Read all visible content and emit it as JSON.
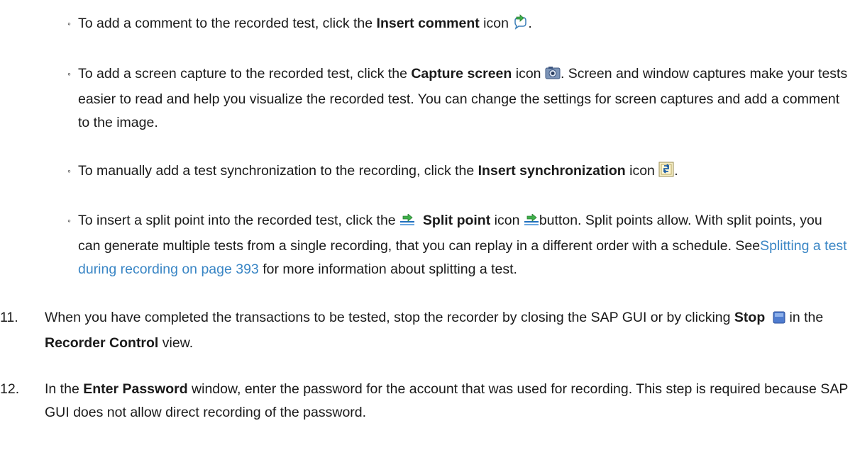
{
  "steps": [
    {
      "type": "bullet",
      "pre": "To add a comment to the recorded test, click the ",
      "bold": "Insert comment",
      "post": " icon ",
      "end": ".",
      "icon": "insert-comment-icon"
    },
    {
      "type": "bullet",
      "pre": "To add a screen capture to the recorded test, click the ",
      "bold": "Capture screen",
      "post": " icon ",
      "end": ". Screen and window captures make your tests easier to read and help you visualize the recorded test. You can change the settings for screen captures and add a comment to the image.",
      "icon": "camera-icon"
    },
    {
      "type": "bullet",
      "pre": "To manually add a test synchronization to the recording, click the ",
      "bold": "Insert synchronization",
      "post": " icon ",
      "end": ".",
      "icon": "synchronization-icon"
    },
    {
      "type": "bullet",
      "pre": "To insert a split point into the recorded test, click the ",
      "bold": "Split point",
      "post": " icon ",
      "mid": "button. Split points allow. With split points, you can generate multiple tests from a single recording, that you can replay in a different order with a schedule. See",
      "link": "Splitting a test during recording on page 393",
      "end": " for more information about splitting a test.",
      "icon": "split-point-icon"
    }
  ],
  "numbered": [
    {
      "num": "11.",
      "pre": "When you have completed the transactions to be tested, stop the recorder by closing the SAP GUI or by clicking ",
      "bold1": "Stop",
      "mid": " in the ",
      "bold2": "Recorder Control",
      "end": " view.",
      "icon": "stop-icon"
    },
    {
      "num": "12.",
      "pre": "In the ",
      "bold1": "Enter Password",
      "end": " window, enter the password for the account that was used for recording. This step is required because SAP GUI does not allow direct recording of the password."
    }
  ],
  "colors": {
    "link": "#3a86c5",
    "text": "#1a1a1a"
  }
}
